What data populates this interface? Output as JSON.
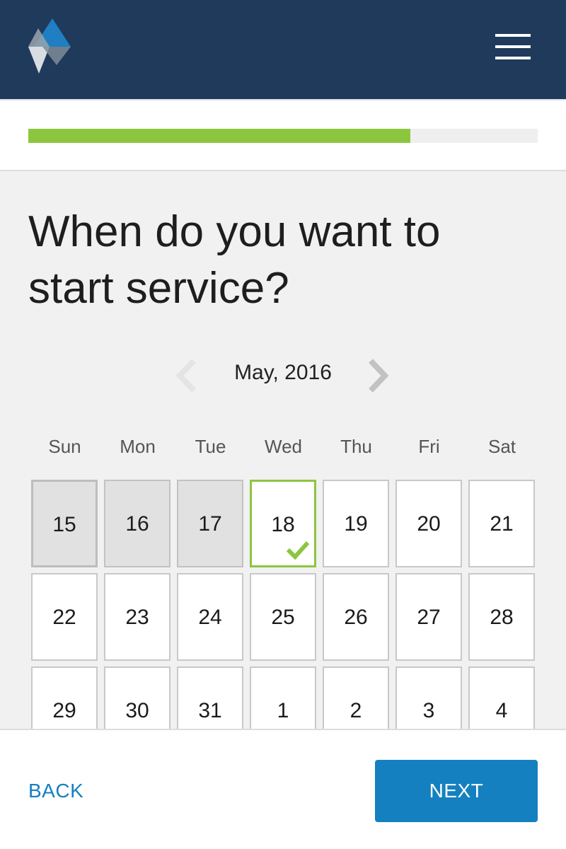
{
  "header": {
    "logo_icon": "diamond-logo-icon",
    "menu_icon": "hamburger-menu-icon",
    "background_color": "#1f3a5b"
  },
  "progress": {
    "value_percent": 75,
    "fill_color": "#8cc63f",
    "track_color": "#efefef"
  },
  "question": {
    "title": "When do you want to start service?"
  },
  "calendar": {
    "month_label": "May, 2016",
    "prev_icon": "chevron-left-icon",
    "next_icon": "chevron-right-icon",
    "weekdays": [
      "Sun",
      "Mon",
      "Tue",
      "Wed",
      "Thu",
      "Fri",
      "Sat"
    ],
    "weeks": [
      [
        "15",
        "16",
        "17",
        "18",
        "19",
        "20",
        "21"
      ],
      [
        "22",
        "23",
        "24",
        "25",
        "26",
        "27",
        "28"
      ],
      [
        "29",
        "30",
        "31",
        "1",
        "2",
        "3",
        "4"
      ]
    ],
    "disabled_days": [
      "15",
      "16",
      "17"
    ],
    "today": "15",
    "selected_day": "18",
    "selected_icon": "checkmark-icon",
    "selected_color": "#8cc63f"
  },
  "footer": {
    "back_label": "BACK",
    "next_label": "NEXT",
    "accent_color": "#1580bf"
  }
}
